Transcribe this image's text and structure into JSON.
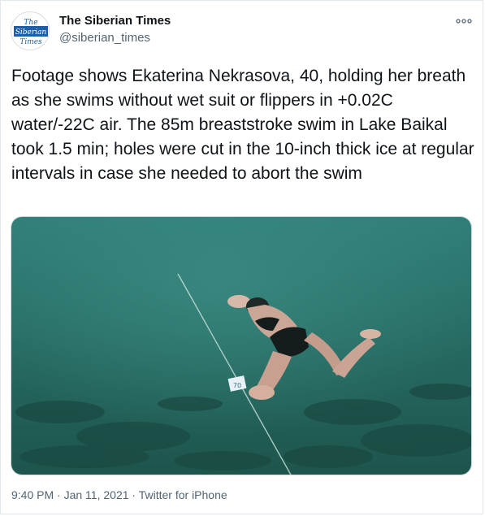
{
  "account": {
    "avatar_lines": [
      "The",
      "Siberian",
      "Times"
    ],
    "display_name": "The Siberian Times",
    "handle": "@siberian_times"
  },
  "menu_icon": "more-dots-icon",
  "tweet": {
    "text": "Footage shows Ekaterina Nekrasova, 40, holding her breath as she swims without wet suit or flippers in +0.02C water/-22C air. The 85m breaststroke swim in Lake Baikal took 1.5 min; holes were cut in the 10-inch thick ice at regular intervals in case she needed to abort the swim",
    "media_marker_label": "70"
  },
  "meta": {
    "time": "9:40 PM",
    "separator_1": " · ",
    "date": "Jan 11, 2021",
    "separator_2": " · ",
    "source": "Twitter for iPhone"
  },
  "colors": {
    "water_top": "#2f7a74",
    "water_bottom": "#1f5b52",
    "text_primary": "#0f1419",
    "text_secondary": "#536471",
    "border": "#e1e8ed"
  }
}
